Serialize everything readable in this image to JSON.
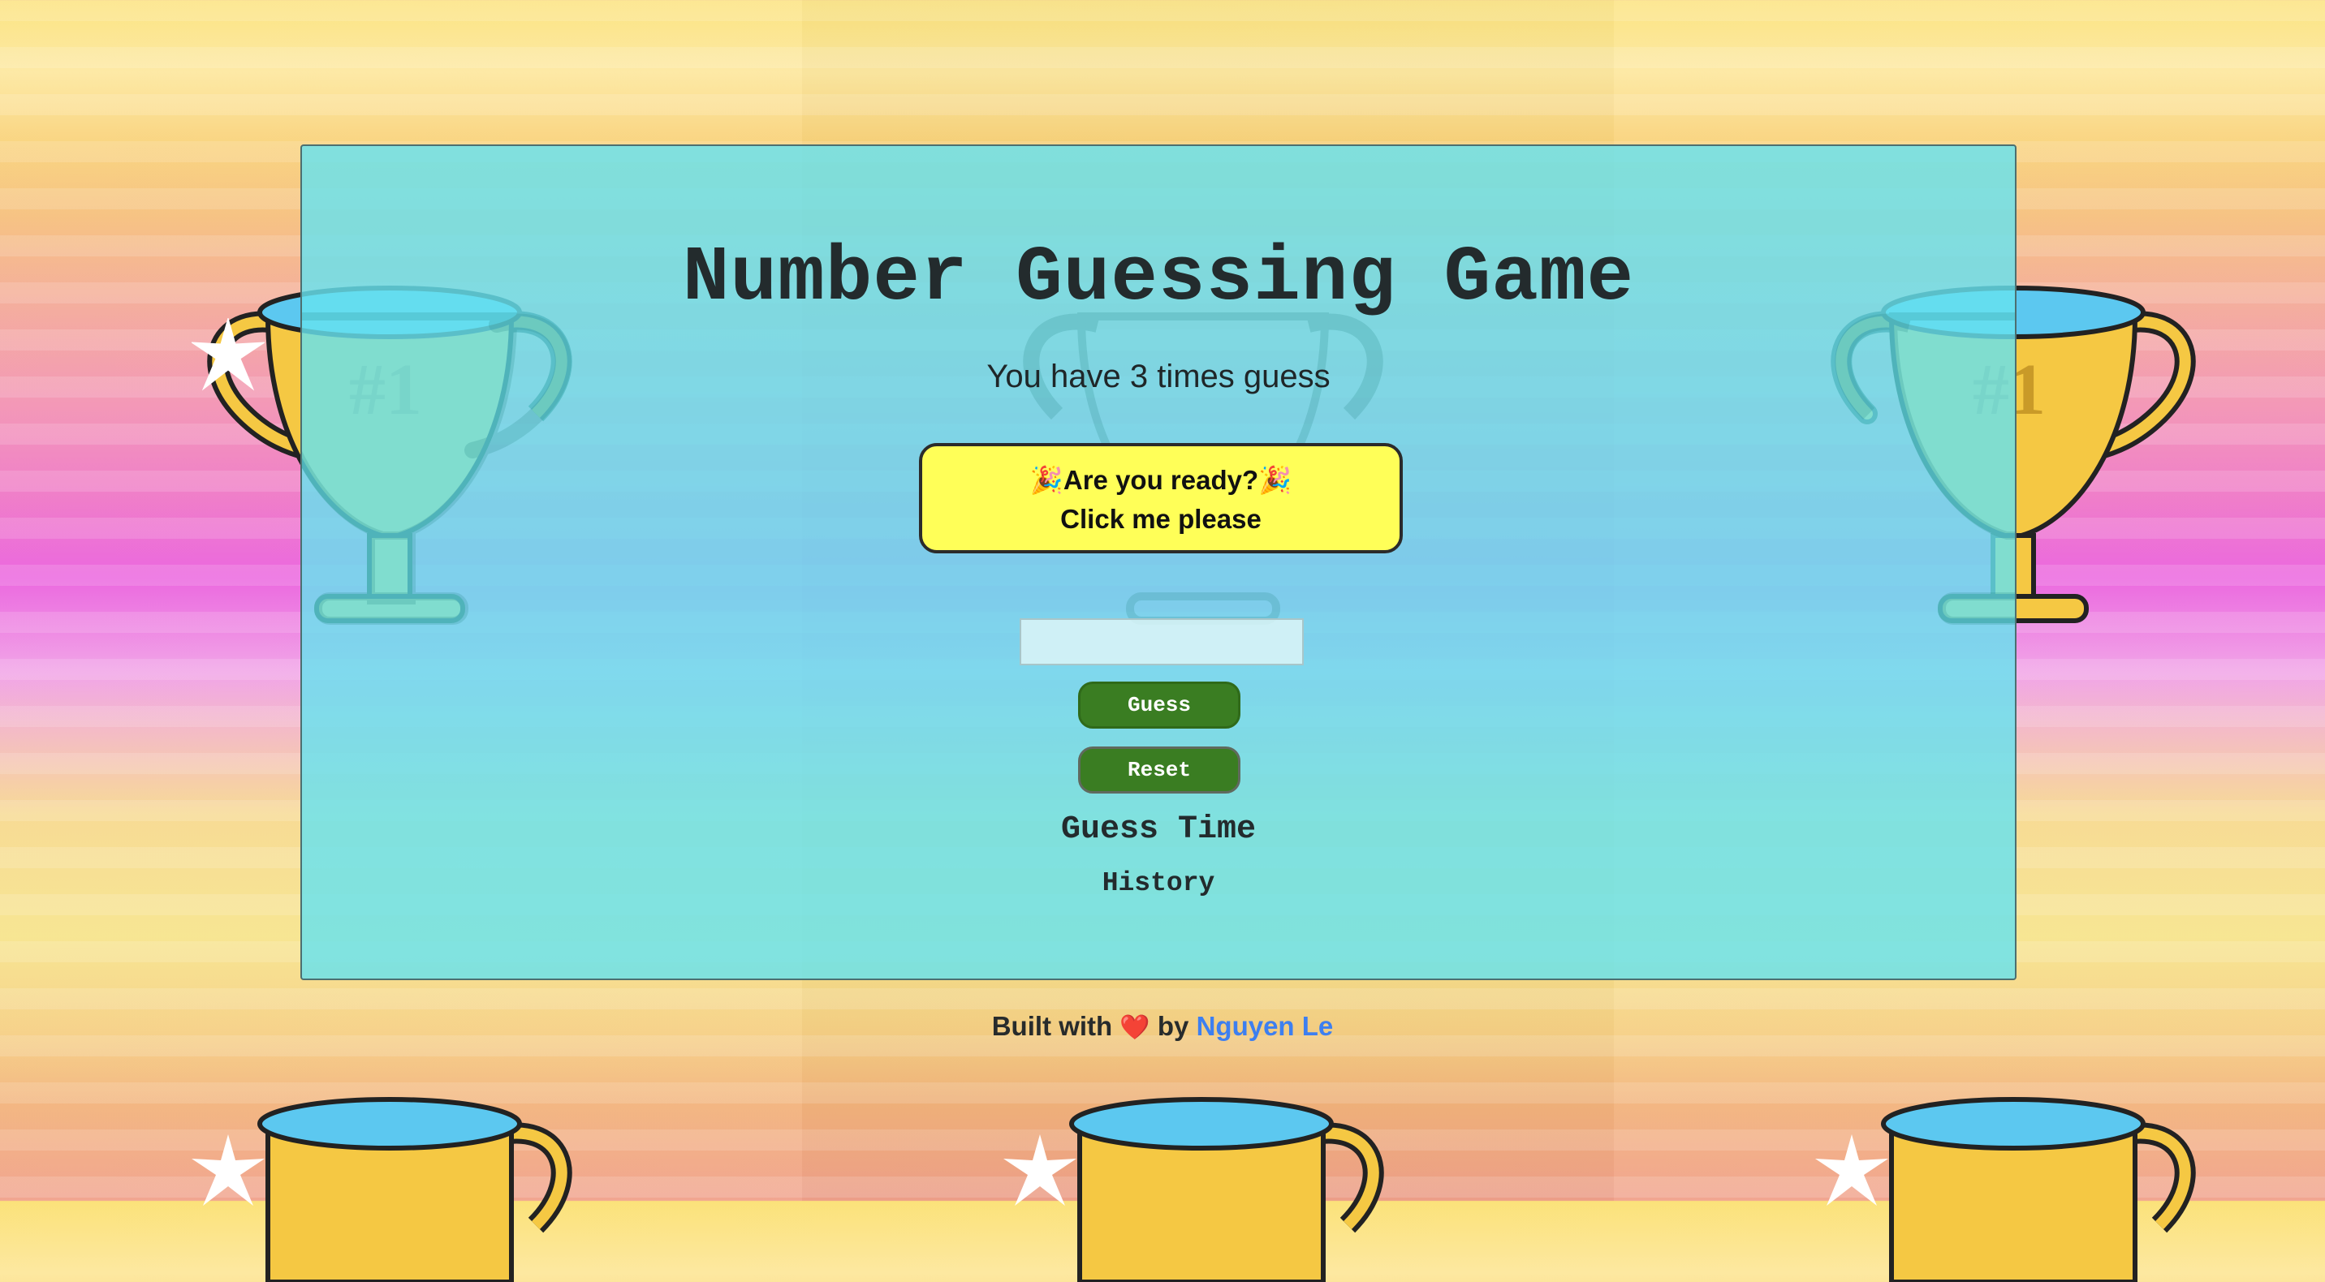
{
  "game": {
    "title": "Number Guessing Game",
    "subtitle": "You have 3 times guess",
    "ready_button": {
      "line1": "🎉Are you ready?🎉",
      "line2": "Click me please"
    },
    "guess_input": {
      "value": "",
      "placeholder": ""
    },
    "guess_button_label": "Guess",
    "reset_button_label": "Reset",
    "guess_time_label": "Guess Time",
    "history_label": "History"
  },
  "footer": {
    "prefix": "Built with",
    "heart": "❤️",
    "by": "by",
    "author": "Nguyen Le"
  },
  "colors": {
    "panel": "#66e2ee",
    "ready_button": "#ffff58",
    "action_button": "#3a7d22",
    "link": "#3d7ff0"
  },
  "icons": [
    "trophy-icon",
    "sparkle-icon",
    "heart-icon",
    "party-popper-icon"
  ]
}
